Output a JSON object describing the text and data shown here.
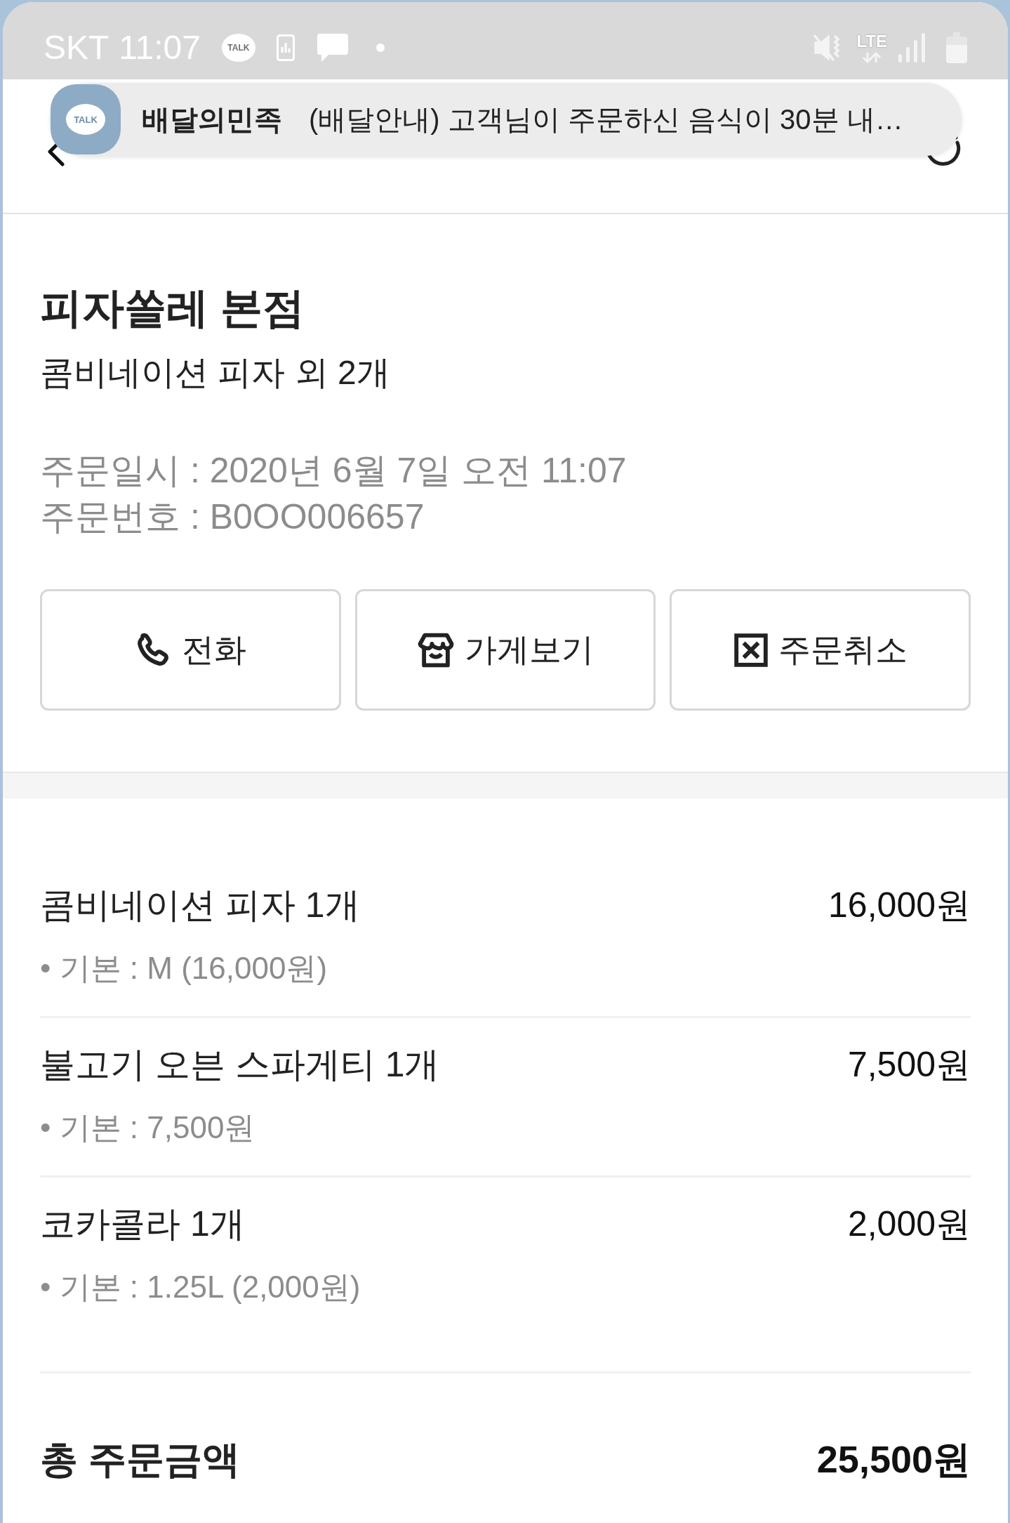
{
  "status_bar": {
    "carrier": "SKT",
    "time": "11:07",
    "talk_label": "TALK",
    "network": "LTE"
  },
  "notification": {
    "icon_label": "TALK",
    "app": "배달의민족",
    "message": "(배달안내) 고객님이 주문하신 음식이 30분 내…"
  },
  "store": {
    "name": "피자쏠레 본점",
    "summary": "콤비네이션 피자 외 2개"
  },
  "order_info": [
    "주문일시 : 2020년 6월 7일 오전 11:07",
    "주문번호 : B0OO006657"
  ],
  "actions": [
    {
      "kind": "phone",
      "label": "전화"
    },
    {
      "kind": "store",
      "label": "가게보기"
    },
    {
      "kind": "cancel",
      "label": "주문취소"
    }
  ],
  "items": [
    {
      "name": "콤비네이션 피자 1개",
      "price": "16,000원",
      "option": "• 기본 : M (16,000원)"
    },
    {
      "name": "불고기 오븐 스파게티 1개",
      "price": "7,500원",
      "option": "• 기본 : 7,500원"
    },
    {
      "name": "코카콜라 1개",
      "price": "2,000원",
      "option": "• 기본 : 1.25L (2,000원)"
    }
  ],
  "total": {
    "label": "총 주문금액",
    "amount": "25,500원"
  }
}
